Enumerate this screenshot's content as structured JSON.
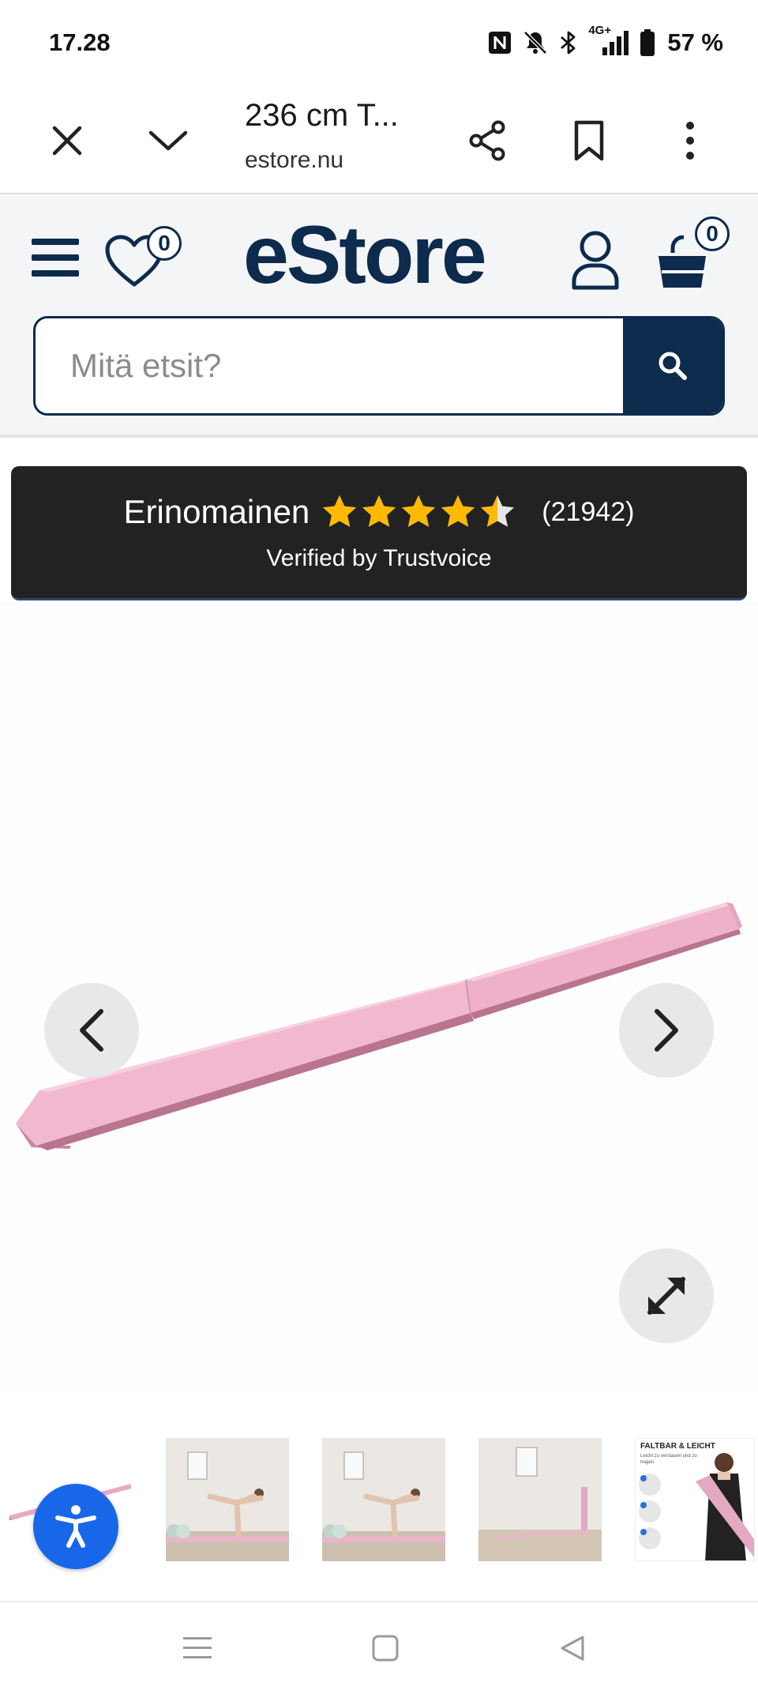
{
  "status_bar": {
    "time": "17.28",
    "battery": "57 %",
    "network": "4G+",
    "icons": [
      "nfc-icon",
      "bell-off-icon",
      "bluetooth-icon",
      "signal-icon",
      "battery-icon"
    ]
  },
  "browser": {
    "tab_title": "236 cm T...",
    "url": "estore.nu",
    "icons": [
      "close-icon",
      "chevron-down-icon",
      "share-icon",
      "bookmark-icon",
      "more-vertical-icon"
    ]
  },
  "header": {
    "logo": "eStore",
    "wishlist_count": "0",
    "cart_count": "0",
    "search_placeholder": "Mitä etsit?",
    "brand_color": "#0c2b4d"
  },
  "trust": {
    "label": "Erinomainen",
    "rating": 4.5,
    "max_rating": 5,
    "count": "(21942)",
    "verified": "Verified by Trustvoice",
    "star_color": "#ffb900"
  },
  "gallery": {
    "thumbnail_count": 5,
    "selected_index": 0,
    "thumb5_title": "FALTBAR & LEICHT",
    "thumb5_subtitle": "Leicht zu verstauen und zu tragen"
  },
  "accessibility": {
    "color": "#1767e8"
  }
}
